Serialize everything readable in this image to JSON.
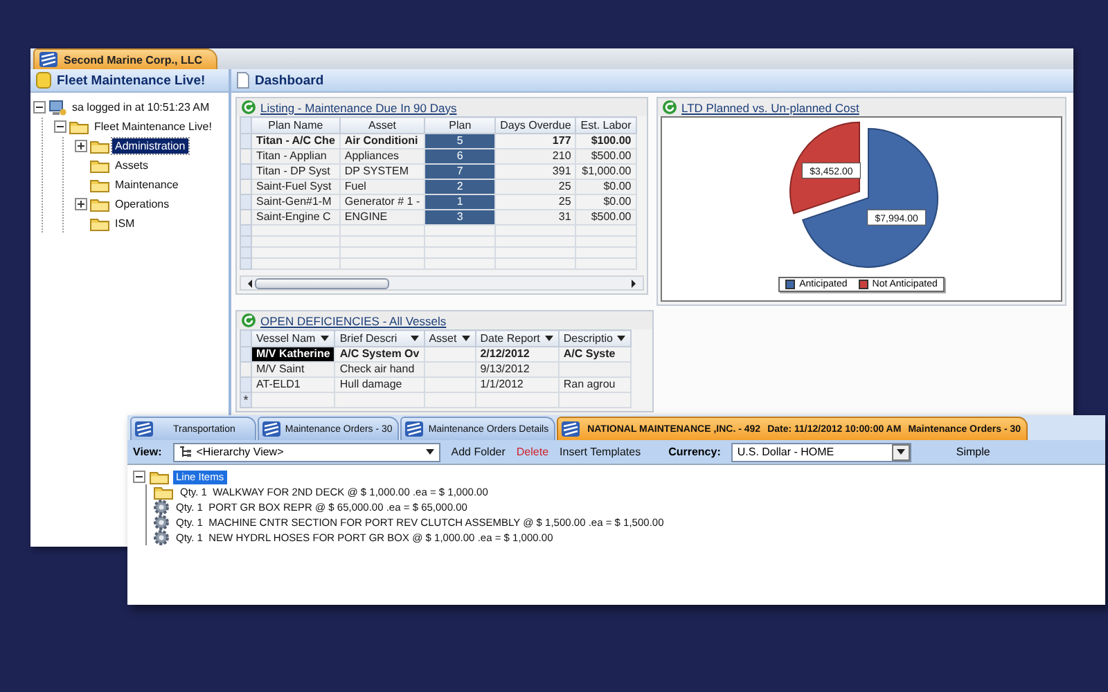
{
  "main_window": {
    "tab": "Second Marine Corp., LLC",
    "sidebar": {
      "title": "Fleet Maintenance Live!",
      "tree": [
        {
          "label": "sa logged in at 10:51:23 AM",
          "kind": "user",
          "expanded": true,
          "selected": false,
          "children": [
            {
              "label": "Fleet Maintenance Live!",
              "kind": "folder",
              "expanded": true,
              "selected": false,
              "children": [
                {
                  "label": "Administration",
                  "kind": "folder",
                  "expanded": false,
                  "selected": true
                },
                {
                  "label": "Assets",
                  "kind": "folder",
                  "selected": false
                },
                {
                  "label": "Maintenance",
                  "kind": "folder",
                  "selected": false
                },
                {
                  "label": "Operations",
                  "kind": "folder",
                  "expanded": false,
                  "selected": false
                },
                {
                  "label": "ISM",
                  "kind": "folder",
                  "selected": false
                }
              ]
            }
          ]
        }
      ]
    },
    "dashboard": {
      "title": "Dashboard",
      "listing": {
        "title": "Listing - Maintenance Due In 90 Days",
        "columns": [
          "Plan Name",
          "Asset",
          "Plan",
          "Days Overdue",
          "Est. Labor"
        ],
        "rows": [
          {
            "cells": [
              "Titan - A/C Che",
              "Air Conditioni",
              "5",
              "177",
              "$100.00"
            ],
            "selected": true
          },
          {
            "cells": [
              "Titan - Applian",
              "Appliances",
              "6",
              "210",
              "$500.00"
            ],
            "selected": false
          },
          {
            "cells": [
              "Titan - DP Syst",
              "DP SYSTEM",
              "7",
              "391",
              "$1,000.00"
            ],
            "selected": false
          },
          {
            "cells": [
              "Saint-Fuel Syst",
              "Fuel",
              "2",
              "25",
              "$0.00"
            ],
            "selected": false
          },
          {
            "cells": [
              "Saint-Gen#1-M",
              "Generator # 1 -",
              "1",
              "25",
              "$0.00"
            ],
            "selected": false
          },
          {
            "cells": [
              "Saint-Engine C",
              "ENGINE",
              "3",
              "31",
              "$500.00"
            ],
            "selected": false
          }
        ]
      },
      "cost_chart": {
        "title": "LTD Planned vs. Un-planned Cost",
        "chart_data": {
          "type": "pie",
          "categories": [
            "Anticipated",
            "Not Anticipated"
          ],
          "values": [
            7994,
            3452
          ],
          "value_labels": [
            "$7,994.00",
            "$3,452.00"
          ],
          "legend": "bottom"
        }
      },
      "deficiencies": {
        "title": "OPEN DEFICIENCIES - All Vessels",
        "columns": [
          "Vessel Nam",
          "Brief Descri",
          "Asset",
          "Date Report",
          "Descriptio"
        ],
        "rows": [
          {
            "cells": [
              "M/V Katherine",
              "A/C System Ov",
              null,
              "2/12/2012",
              "A/C Syste"
            ],
            "selected": true
          },
          {
            "cells": [
              "M/V Saint",
              "Check air hand",
              null,
              "9/13/2012",
              null
            ],
            "selected": false
          },
          {
            "cells": [
              "AT-ELD1",
              "Hull damage",
              null,
              "1/1/2012",
              "Ran agrou"
            ],
            "selected": false
          }
        ],
        "new_row_marker": "*"
      }
    }
  },
  "orders_window": {
    "tabs": [
      {
        "label": "Transportation",
        "selected": false
      },
      {
        "label": "Maintenance Orders - 30",
        "selected": false
      },
      {
        "label": "Maintenance Orders Details",
        "selected": false
      },
      {
        "label": "NATIONAL MAINTENANCE ,INC. - 492",
        "date": "Date: 11/12/2012 10:00:00 AM",
        "orders": "Maintenance Orders - 30",
        "selected": true
      }
    ],
    "toolbar": {
      "view_label": "View:",
      "view": "<Hierarchy View>",
      "actions": [
        {
          "label": "Add Folder",
          "kind": "normal"
        },
        {
          "label": "Delete",
          "kind": "danger"
        },
        {
          "label": "Insert Templates",
          "kind": "normal"
        }
      ],
      "currency_label": "Currency:",
      "currency": "U.S. Dollar - HOME",
      "mode": "Simple"
    },
    "tree": {
      "label": "Line Items",
      "expanded": true,
      "selected": true,
      "children": [
        {
          "kind": "folder",
          "qty": "Qty. 1",
          "text": "WALKWAY FOR 2ND DECK @ $ 1,000.00 .ea = $ 1,000.00",
          "selected": false
        },
        {
          "kind": "gear",
          "qty": "Qty. 1",
          "text": "PORT GR BOX REPR @ $ 65,000.00 .ea = $ 65,000.00",
          "selected": false
        },
        {
          "kind": "gear",
          "qty": "Qty. 1",
          "text": "MACHINE CNTR SECTION FOR PORT REV CLUTCH ASSEMBLY @ $ 1,500.00 .ea = $ 1,500.00",
          "selected": false
        },
        {
          "kind": "gear",
          "qty": "Qty. 1",
          "text": "NEW HYDRL HOSES FOR PORT GR BOX @ $ 1,000.00 .ea = $ 1,000.00",
          "selected": false
        }
      ]
    }
  }
}
